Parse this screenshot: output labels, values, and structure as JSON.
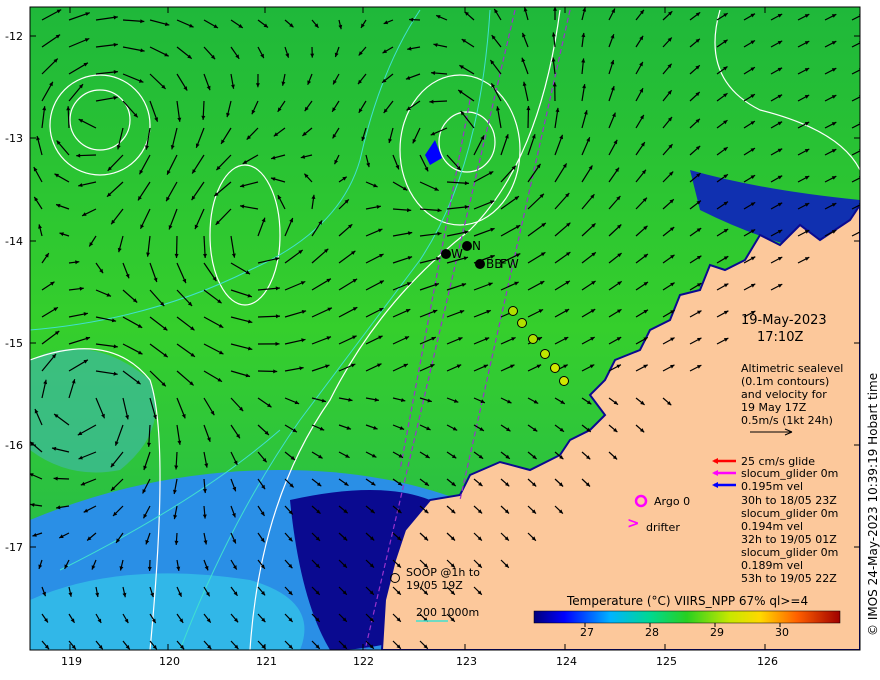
{
  "map": {
    "axes": {
      "lon_ticks": [
        "119",
        "120",
        "121",
        "122",
        "123",
        "124",
        "125",
        "126"
      ],
      "lat_ticks": [
        "-12",
        "-13",
        "-14",
        "-15",
        "-16",
        "-17"
      ]
    },
    "timestamp": {
      "date": "19-May-2023",
      "time": "17:10Z"
    },
    "altimetry_note": [
      "Altimetric sealevel",
      "(0.1m contours)",
      "and velocity for",
      "19 May 17Z",
      "0.5m/s (1kt 24h)"
    ],
    "glider_legend": {
      "speed": "25 cm/s glide",
      "lines": [
        "slocum_glider 0m",
        "0.195m vel",
        "30h to 18/05 23Z",
        "slocum_glider 0m",
        "0.194m vel",
        "32h to 19/05 01Z",
        "slocum_glider 0m",
        "0.189m vel",
        "53h to 19/05 22Z"
      ],
      "arrow_colors": [
        "#ff0000",
        "#ff00ff",
        "#0000ff"
      ]
    },
    "argo": {
      "label": "Argo 0",
      "color": "#ff00ff"
    },
    "drifter": {
      "label": "drifter",
      "symbol": ">",
      "color": "#ff00ff"
    },
    "soop": {
      "line1": "SOOP @1h to",
      "line2": "19/05 19Z"
    },
    "bathymetry": {
      "label": "200  1000m",
      "color": "#40e0d0"
    },
    "stations": [
      {
        "label": "W"
      },
      {
        "label": "N"
      },
      {
        "label": "BB"
      },
      {
        "label": "FW"
      }
    ],
    "colorbar": {
      "title": "Temperature (°C) VIIRS_NPP 67% ql>=4",
      "ticks": [
        "27",
        "28",
        "29",
        "30"
      ],
      "min": 26.3,
      "max": 31.0
    },
    "copyright": "© IMOS 24-May-2023 10:39:19 Hobart time",
    "colors": {
      "land": "#fcc89b",
      "sea_green": "#2ecb2e",
      "sea_blue": "#2a8fe6",
      "deep_blue": "#0a0a90",
      "contour": "#ffffff",
      "track": "#9933cc"
    }
  }
}
